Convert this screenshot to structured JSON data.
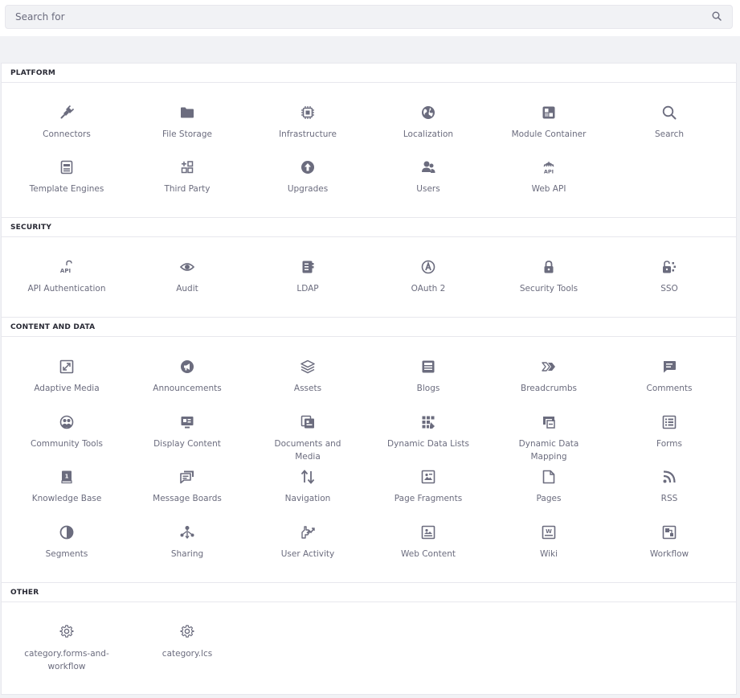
{
  "search": {
    "placeholder": "Search for"
  },
  "colors": {
    "icon": "#6b6c7e",
    "panel_bg": "#ffffff",
    "page_bg": "#f1f2f5",
    "header_text": "#272833"
  },
  "sections": [
    {
      "title": "PLATFORM",
      "items": [
        {
          "label": "Connectors",
          "icon": "plug-icon"
        },
        {
          "label": "File Storage",
          "icon": "folder-icon"
        },
        {
          "label": "Infrastructure",
          "icon": "chip-icon"
        },
        {
          "label": "Localization",
          "icon": "globe-icon"
        },
        {
          "label": "Module Container",
          "icon": "module-icon"
        },
        {
          "label": "Search",
          "icon": "search-icon"
        },
        {
          "label": "Template Engines",
          "icon": "template-icon"
        },
        {
          "label": "Third Party",
          "icon": "third-party-icon"
        },
        {
          "label": "Upgrades",
          "icon": "upgrade-icon"
        },
        {
          "label": "Users",
          "icon": "users-icon"
        },
        {
          "label": "Web API",
          "icon": "web-api-icon"
        }
      ]
    },
    {
      "title": "SECURITY",
      "items": [
        {
          "label": "API Authentication",
          "icon": "api-lock-icon"
        },
        {
          "label": "Audit",
          "icon": "eye-icon"
        },
        {
          "label": "LDAP",
          "icon": "ldap-icon"
        },
        {
          "label": "OAuth 2",
          "icon": "oauth-icon"
        },
        {
          "label": "Security Tools",
          "icon": "lock-icon"
        },
        {
          "label": "SSO",
          "icon": "sso-icon"
        }
      ]
    },
    {
      "title": "CONTENT AND DATA",
      "items": [
        {
          "label": "Adaptive Media",
          "icon": "adaptive-media-icon"
        },
        {
          "label": "Announcements",
          "icon": "announcement-icon"
        },
        {
          "label": "Assets",
          "icon": "layers-icon"
        },
        {
          "label": "Blogs",
          "icon": "blog-icon"
        },
        {
          "label": "Breadcrumbs",
          "icon": "breadcrumb-icon"
        },
        {
          "label": "Comments",
          "icon": "comment-icon"
        },
        {
          "label": "Community Tools",
          "icon": "community-icon"
        },
        {
          "label": "Display Content",
          "icon": "display-content-icon"
        },
        {
          "label": "Documents and Media",
          "icon": "documents-icon"
        },
        {
          "label": "Dynamic Data Lists",
          "icon": "data-list-icon"
        },
        {
          "label": "Dynamic Data Mapping",
          "icon": "data-mapping-icon"
        },
        {
          "label": "Forms",
          "icon": "forms-icon"
        },
        {
          "label": "Knowledge Base",
          "icon": "book-icon"
        },
        {
          "label": "Message Boards",
          "icon": "message-board-icon"
        },
        {
          "label": "Navigation",
          "icon": "navigation-icon"
        },
        {
          "label": "Page Fragments",
          "icon": "fragment-icon"
        },
        {
          "label": "Pages",
          "icon": "page-icon"
        },
        {
          "label": "RSS",
          "icon": "rss-icon"
        },
        {
          "label": "Segments",
          "icon": "segments-icon"
        },
        {
          "label": "Sharing",
          "icon": "share-icon"
        },
        {
          "label": "User Activity",
          "icon": "activity-icon"
        },
        {
          "label": "Web Content",
          "icon": "web-content-icon"
        },
        {
          "label": "Wiki",
          "icon": "wiki-icon"
        },
        {
          "label": "Workflow",
          "icon": "workflow-icon"
        }
      ]
    },
    {
      "title": "OTHER",
      "items": [
        {
          "label": "category.forms-and-workflow",
          "icon": "gear-icon"
        },
        {
          "label": "category.lcs",
          "icon": "gear-icon"
        }
      ]
    }
  ]
}
